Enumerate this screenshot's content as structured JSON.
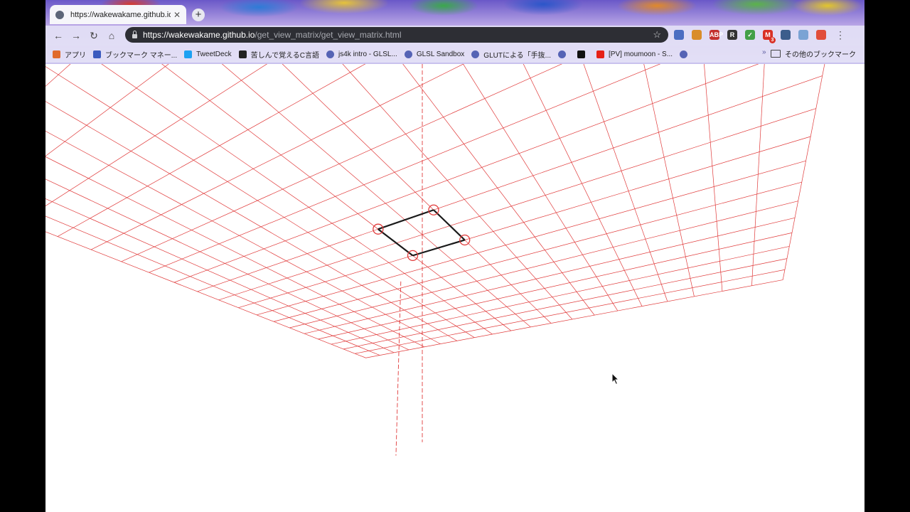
{
  "tab": {
    "title": "https://wakewakame.github.io/",
    "close": "✕",
    "new": "+"
  },
  "nav": {
    "back": "←",
    "forward": "→",
    "reload": "↻",
    "home": "⌂"
  },
  "omnibox": {
    "host": "https://wakewakame.github.io",
    "path": "/get_view_matrix/get_view_matrix.html",
    "star": "☆"
  },
  "extensions": [
    {
      "name": "pocket-icon",
      "label": "",
      "color": "#4b6ec2"
    },
    {
      "name": "download-icon",
      "label": "",
      "color": "#d98d2a"
    },
    {
      "name": "adblock-icon",
      "label": "ABP",
      "color": "#c3302d"
    },
    {
      "name": "stylish-icon",
      "label": "R",
      "color": "#333333"
    },
    {
      "name": "todo-check-icon",
      "label": "✓",
      "color": "#43a047"
    },
    {
      "name": "gmail-icon",
      "label": "M",
      "color": "#d93025"
    },
    {
      "name": "book-icon",
      "label": "",
      "color": "#3c5d8c"
    },
    {
      "name": "save-icon",
      "label": "",
      "color": "#7aa3d4"
    },
    {
      "name": "profile-icon",
      "label": "",
      "color": "#e14d3a"
    }
  ],
  "gmail_badge": "3",
  "menu": "⋮",
  "bookmarks": [
    {
      "name": "bookmark-apps",
      "icon": "apps-grid-icon",
      "label": "アプリ",
      "color": "#e06a2c"
    },
    {
      "name": "bookmark-manager",
      "icon": "star-icon",
      "label": "ブックマーク マネー...",
      "color": "#3c5bbf"
    },
    {
      "name": "bookmark-tweetdeck",
      "icon": "twitter-icon",
      "label": "TweetDeck",
      "color": "#1da1f2"
    },
    {
      "name": "bookmark-c-lang",
      "icon": "c-icon",
      "label": "苦しんで覚えるC言語",
      "color": "#222222"
    },
    {
      "name": "bookmark-js4k",
      "icon": "globe-icon",
      "label": "js4k intro - GLSL...",
      "color": "#5563b5"
    },
    {
      "name": "bookmark-glsl-sandbox",
      "icon": "globe-icon",
      "label": "GLSL Sandbox",
      "color": "#5563b5"
    },
    {
      "name": "bookmark-glut",
      "icon": "globe-icon",
      "label": "GLUTによる「手抜...",
      "color": "#5563b5"
    },
    {
      "name": "bookmark-globe",
      "icon": "globe-icon",
      "label": "",
      "color": "#5563b5"
    },
    {
      "name": "bookmark-g",
      "icon": "g-icon",
      "label": "",
      "color": "#111111"
    },
    {
      "name": "bookmark-youtube",
      "icon": "youtube-icon",
      "label": "[PV] moumoon - S...",
      "color": "#e62117"
    },
    {
      "name": "bookmark-globe-2",
      "icon": "globe-icon",
      "label": "",
      "color": "#5563b5"
    }
  ],
  "bookmarks_overflow": "»",
  "other_bookmarks": "その他のブックマーク",
  "scene": {
    "grid_color": "#e03a3a",
    "square_color": "#1a1a1a",
    "handle_color": "#e03a3a"
  }
}
